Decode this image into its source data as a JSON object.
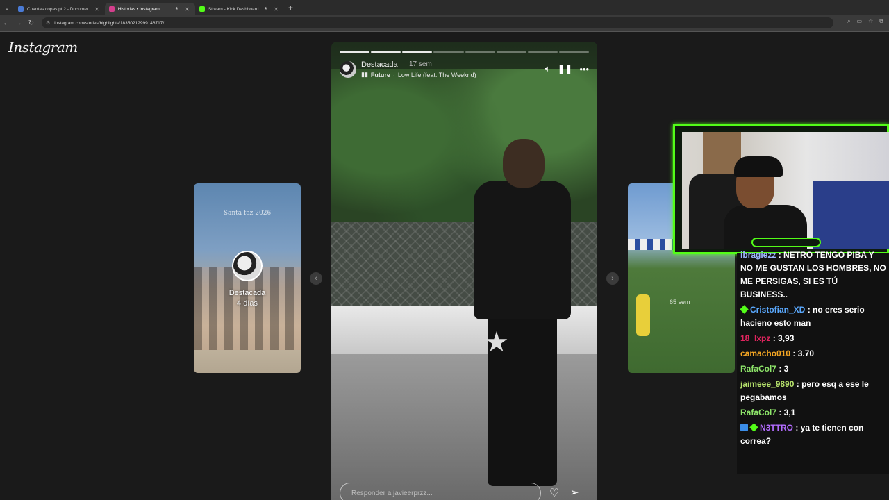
{
  "browser": {
    "tabs": [
      {
        "title": "Cuantas copas pt 2 - Documen",
        "favicon_color": "#4a7bd6",
        "active": false
      },
      {
        "title": "Historias • Instagram",
        "favicon_color": "#d43f8d",
        "active": true
      },
      {
        "title": "Stream - Kick Dashboard",
        "favicon_color": "#53fc18",
        "active": false
      }
    ],
    "url": "instagram.com/stories/highlights/18350212999146717/",
    "new_tab": "+"
  },
  "instagram": {
    "logo": "Instagram",
    "left_card": {
      "overlay_title": "Santa faz 2026",
      "label": "Destacada",
      "sub": "4 días"
    },
    "story": {
      "segments_total": 8,
      "segments_done": 3,
      "username": "Destacada",
      "time": "17 sem",
      "music_artist": "Future",
      "music_song": "Low Life (feat. The Weeknd)",
      "reply_placeholder": "Responder a javieerprzz..."
    },
    "right_card": {
      "time_label": "65 sem"
    }
  },
  "chat": {
    "messages": [
      {
        "user": "ibragiezz",
        "user_color": "#9fb8ff",
        "text": ": NETRO TENGO PIBA Y NO ME GUSTAN LOS HOMBRES, NO ME PERSIGAS, SI ES TÚ BUSINESS..",
        "badges": []
      },
      {
        "user": "Cristofian_XD",
        "user_color": "#5aa9ff",
        "text": ": no eres serio hacieno esto man",
        "badges": [
          "green"
        ]
      },
      {
        "user": "18_lxpz",
        "user_color": "#e0245e",
        "text": ": 3,93",
        "badges": []
      },
      {
        "user": "camacho010",
        "user_color": "#f5a623",
        "text": ": 3.70",
        "badges": []
      },
      {
        "user": "RafaCol7",
        "user_color": "#8ee66a",
        "text": ": 3",
        "badges": []
      },
      {
        "user": "jaimeee_9890",
        "user_color": "#b7e36c",
        "text": ": pero esq a ese le pegabamos",
        "badges": []
      },
      {
        "user": "RafaCol7",
        "user_color": "#8ee66a",
        "text": ": 3,1",
        "badges": []
      },
      {
        "user": "N3TTRO",
        "user_color": "#b36cff",
        "text": ": ya te tienen con correa?",
        "badges": [
          "blue",
          "green"
        ]
      }
    ]
  }
}
